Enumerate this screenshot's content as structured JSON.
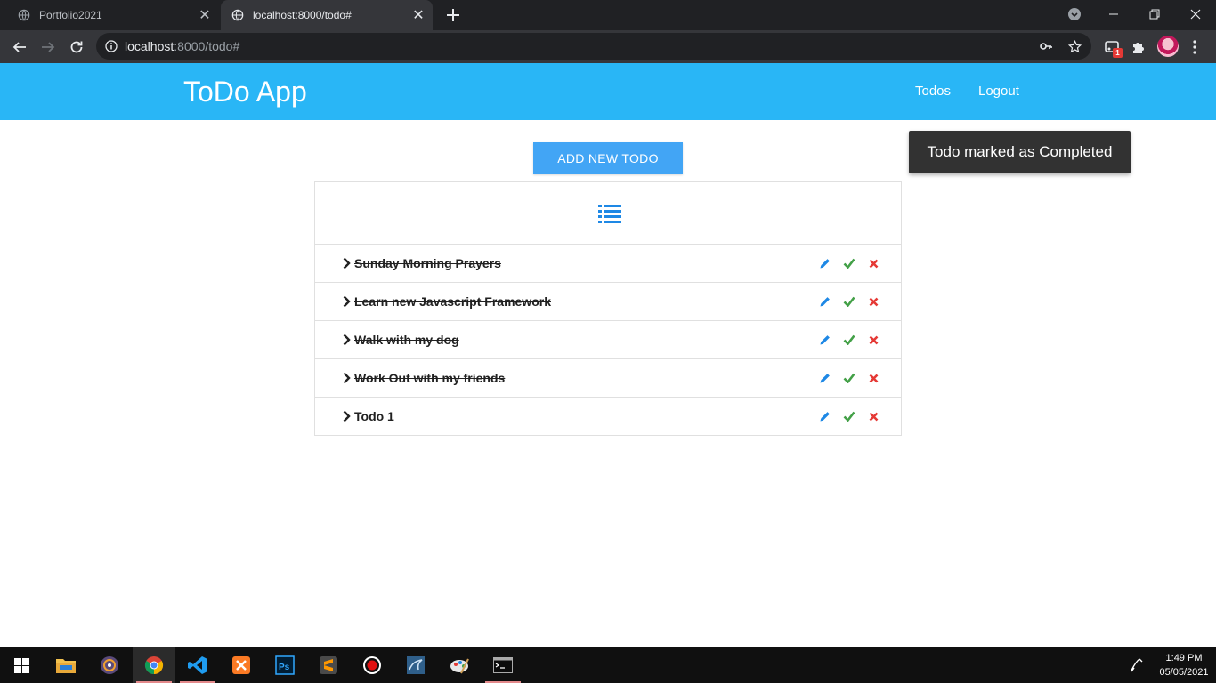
{
  "browser": {
    "tabs": [
      {
        "title": "Portfolio2021",
        "active": false
      },
      {
        "title": "localhost:8000/todo#",
        "active": true
      }
    ],
    "url_host": "localhost",
    "url_path": ":8000/todo#",
    "extension_badge": "1"
  },
  "app": {
    "brand": "ToDo App",
    "nav": {
      "todos": "Todos",
      "logout": "Logout"
    },
    "add_button": "ADD NEW TODO",
    "toast": "Todo marked as Completed",
    "todos": [
      {
        "title": "Sunday Morning Prayers",
        "completed": true
      },
      {
        "title": "Learn new Javascript Framework",
        "completed": true
      },
      {
        "title": "Walk with my dog",
        "completed": true
      },
      {
        "title": "Work Out with my friends",
        "completed": true
      },
      {
        "title": "Todo 1",
        "completed": false
      }
    ]
  },
  "taskbar": {
    "time": "1:49 PM",
    "date": "05/05/2021"
  },
  "colors": {
    "navbar": "#29b6f6",
    "button": "#42a5f5",
    "edit": "#1e88e5",
    "complete": "#43a047",
    "delete": "#e53935"
  }
}
